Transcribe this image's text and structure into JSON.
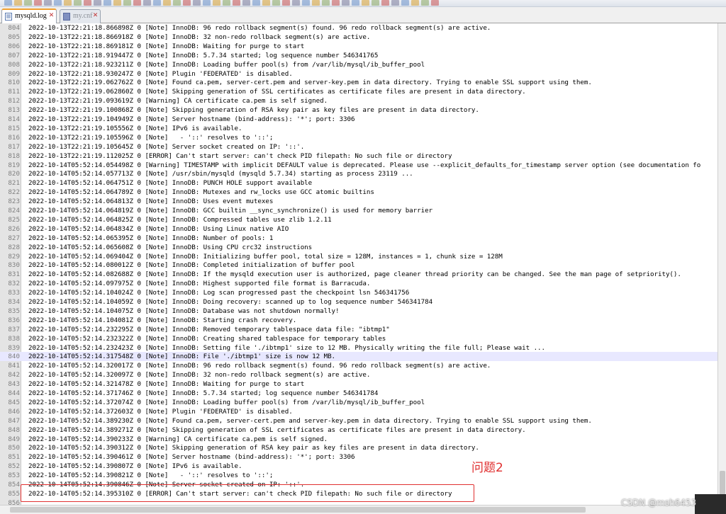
{
  "tabs": [
    {
      "label": "mysqld.log",
      "active": true
    },
    {
      "label": "my.cnf",
      "active": false
    }
  ],
  "highlighted_line": "840",
  "lines": [
    {
      "num": "804",
      "text": "2022-10-13T22:21:18.866898Z 0 [Note] InnoDB: 96 redo rollback segment(s) found. 96 redo rollback segment(s) are active."
    },
    {
      "num": "805",
      "text": "2022-10-13T22:21:18.866918Z 0 [Note] InnoDB: 32 non-redo rollback segment(s) are active."
    },
    {
      "num": "806",
      "text": "2022-10-13T22:21:18.869181Z 0 [Note] InnoDB: Waiting for purge to start"
    },
    {
      "num": "807",
      "text": "2022-10-13T22:21:18.919447Z 0 [Note] InnoDB: 5.7.34 started; log sequence number 546341765"
    },
    {
      "num": "808",
      "text": "2022-10-13T22:21:18.923211Z 0 [Note] InnoDB: Loading buffer pool(s) from /var/lib/mysql/ib_buffer_pool"
    },
    {
      "num": "809",
      "text": "2022-10-13T22:21:18.930247Z 0 [Note] Plugin 'FEDERATED' is disabled."
    },
    {
      "num": "810",
      "text": "2022-10-13T22:21:19.062762Z 0 [Note] Found ca.pem, server-cert.pem and server-key.pem in data directory. Trying to enable SSL support using them."
    },
    {
      "num": "811",
      "text": "2022-10-13T22:21:19.062860Z 0 [Note] Skipping generation of SSL certificates as certificate files are present in data directory."
    },
    {
      "num": "812",
      "text": "2022-10-13T22:21:19.093619Z 0 [Warning] CA certificate ca.pem is self signed."
    },
    {
      "num": "813",
      "text": "2022-10-13T22:21:19.100868Z 0 [Note] Skipping generation of RSA key pair as key files are present in data directory."
    },
    {
      "num": "814",
      "text": "2022-10-13T22:21:19.104949Z 0 [Note] Server hostname (bind-address): '*'; port: 3306"
    },
    {
      "num": "815",
      "text": "2022-10-13T22:21:19.105556Z 0 [Note] IPv6 is available."
    },
    {
      "num": "816",
      "text": "2022-10-13T22:21:19.105596Z 0 [Note]   - '::' resolves to '::';"
    },
    {
      "num": "817",
      "text": "2022-10-13T22:21:19.105645Z 0 [Note] Server socket created on IP: '::'."
    },
    {
      "num": "818",
      "text": "2022-10-13T22:21:19.112025Z 0 [ERROR] Can't start server: can't check PID filepath: No such file or directory"
    },
    {
      "num": "819",
      "text": "2022-10-14T05:52:14.054498Z 0 [Warning] TIMESTAMP with implicit DEFAULT value is deprecated. Please use --explicit_defaults_for_timestamp server option (see documentation fo"
    },
    {
      "num": "820",
      "text": "2022-10-14T05:52:14.057713Z 0 [Note] /usr/sbin/mysqld (mysqld 5.7.34) starting as process 23119 ..."
    },
    {
      "num": "821",
      "text": "2022-10-14T05:52:14.064751Z 0 [Note] InnoDB: PUNCH HOLE support available"
    },
    {
      "num": "822",
      "text": "2022-10-14T05:52:14.064789Z 0 [Note] InnoDB: Mutexes and rw_locks use GCC atomic builtins"
    },
    {
      "num": "823",
      "text": "2022-10-14T05:52:14.064813Z 0 [Note] InnoDB: Uses event mutexes"
    },
    {
      "num": "824",
      "text": "2022-10-14T05:52:14.064819Z 0 [Note] InnoDB: GCC builtin __sync_synchronize() is used for memory barrier"
    },
    {
      "num": "825",
      "text": "2022-10-14T05:52:14.064825Z 0 [Note] InnoDB: Compressed tables use zlib 1.2.11"
    },
    {
      "num": "826",
      "text": "2022-10-14T05:52:14.064834Z 0 [Note] InnoDB: Using Linux native AIO"
    },
    {
      "num": "827",
      "text": "2022-10-14T05:52:14.065395Z 0 [Note] InnoDB: Number of pools: 1"
    },
    {
      "num": "828",
      "text": "2022-10-14T05:52:14.065608Z 0 [Note] InnoDB: Using CPU crc32 instructions"
    },
    {
      "num": "829",
      "text": "2022-10-14T05:52:14.069404Z 0 [Note] InnoDB: Initializing buffer pool, total size = 128M, instances = 1, chunk size = 128M"
    },
    {
      "num": "830",
      "text": "2022-10-14T05:52:14.080012Z 0 [Note] InnoDB: Completed initialization of buffer pool"
    },
    {
      "num": "831",
      "text": "2022-10-14T05:52:14.082688Z 0 [Note] InnoDB: If the mysqld execution user is authorized, page cleaner thread priority can be changed. See the man page of setpriority()."
    },
    {
      "num": "832",
      "text": "2022-10-14T05:52:14.097975Z 0 [Note] InnoDB: Highest supported file format is Barracuda."
    },
    {
      "num": "833",
      "text": "2022-10-14T05:52:14.104024Z 0 [Note] InnoDB: Log scan progressed past the checkpoint lsn 546341756"
    },
    {
      "num": "834",
      "text": "2022-10-14T05:52:14.104059Z 0 [Note] InnoDB: Doing recovery: scanned up to log sequence number 546341784"
    },
    {
      "num": "835",
      "text": "2022-10-14T05:52:14.104075Z 0 [Note] InnoDB: Database was not shutdown normally!"
    },
    {
      "num": "836",
      "text": "2022-10-14T05:52:14.104081Z 0 [Note] InnoDB: Starting crash recovery."
    },
    {
      "num": "837",
      "text": "2022-10-14T05:52:14.232295Z 0 [Note] InnoDB: Removed temporary tablespace data file: \"ibtmp1\""
    },
    {
      "num": "838",
      "text": "2022-10-14T05:52:14.232322Z 0 [Note] InnoDB: Creating shared tablespace for temporary tables"
    },
    {
      "num": "839",
      "text": "2022-10-14T05:52:14.232423Z 0 [Note] InnoDB: Setting file './ibtmp1' size to 12 MB. Physically writing the file full; Please wait ..."
    },
    {
      "num": "840",
      "text": "2022-10-14T05:52:14.317548Z 0 [Note] InnoDB: File './ibtmp1' size is now 12 MB."
    },
    {
      "num": "841",
      "text": "2022-10-14T05:52:14.320017Z 0 [Note] InnoDB: 96 redo rollback segment(s) found. 96 redo rollback segment(s) are active."
    },
    {
      "num": "842",
      "text": "2022-10-14T05:52:14.320097Z 0 [Note] InnoDB: 32 non-redo rollback segment(s) are active."
    },
    {
      "num": "843",
      "text": "2022-10-14T05:52:14.321478Z 0 [Note] InnoDB: Waiting for purge to start"
    },
    {
      "num": "844",
      "text": "2022-10-14T05:52:14.371746Z 0 [Note] InnoDB: 5.7.34 started; log sequence number 546341784"
    },
    {
      "num": "845",
      "text": "2022-10-14T05:52:14.372074Z 0 [Note] InnoDB: Loading buffer pool(s) from /var/lib/mysql/ib_buffer_pool"
    },
    {
      "num": "846",
      "text": "2022-10-14T05:52:14.372603Z 0 [Note] Plugin 'FEDERATED' is disabled."
    },
    {
      "num": "847",
      "text": "2022-10-14T05:52:14.389230Z 0 [Note] Found ca.pem, server-cert.pem and server-key.pem in data directory. Trying to enable SSL support using them."
    },
    {
      "num": "848",
      "text": "2022-10-14T05:52:14.389271Z 0 [Note] Skipping generation of SSL certificates as certificate files are present in data directory."
    },
    {
      "num": "849",
      "text": "2022-10-14T05:52:14.390233Z 0 [Warning] CA certificate ca.pem is self signed."
    },
    {
      "num": "850",
      "text": "2022-10-14T05:52:14.390312Z 0 [Note] Skipping generation of RSA key pair as key files are present in data directory."
    },
    {
      "num": "851",
      "text": "2022-10-14T05:52:14.390461Z 0 [Note] Server hostname (bind-address): '*'; port: 3306"
    },
    {
      "num": "852",
      "text": "2022-10-14T05:52:14.390807Z 0 [Note] IPv6 is available."
    },
    {
      "num": "853",
      "text": "2022-10-14T05:52:14.390821Z 0 [Note]   - '::' resolves to '::';"
    },
    {
      "num": "854",
      "text": "2022-10-14T05:52:14.390846Z 0 [Note] Server socket created on IP: '::'."
    },
    {
      "num": "855",
      "text": "2022-10-14T05:52:14.395310Z 0 [ERROR] Can't start server: can't check PID filepath: No such file or directory"
    },
    {
      "num": "856",
      "text": ""
    }
  ],
  "annotation": {
    "label": "问题2",
    "color": "#e03030"
  },
  "watermark": "CSDN @msh6453",
  "colors": {
    "highlight": "#e8e8ff",
    "active_tab_accent": "#f0a030"
  }
}
